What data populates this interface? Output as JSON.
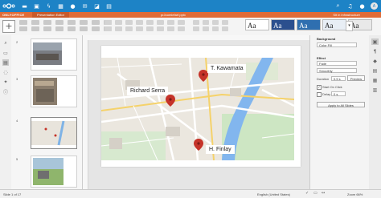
{
  "nextcloud": {
    "apps": [
      "folder-icon",
      "image-icon",
      "pulse-icon",
      "calendar-icon",
      "contacts-icon",
      "mail-icon",
      "deck-icon",
      "office-icon"
    ],
    "right_icons": [
      "search-icon",
      "bell-icon",
      "contacts-icon"
    ],
    "avatar": "A"
  },
  "onlyoffice": {
    "brand": "ONLYOFFICE",
    "tabs": [
      "Presentation Editor",
      "File"
    ],
    "filename": "prJoomlefarf.pptx",
    "user": "Slt in Infrastructure"
  },
  "themes": [
    "Aa",
    "Aa",
    "Aa",
    "Aa",
    "Aa",
    "Aa"
  ],
  "slides": {
    "numbers": [
      "2",
      "3",
      "4",
      "5"
    ]
  },
  "map": {
    "labels": [
      "T. Kawamata",
      "Richard Serra",
      "H. Finlay"
    ]
  },
  "right_panel": {
    "background_title": "Background",
    "background_value": "Color Fill",
    "effect_title": "Effect",
    "effect_value": "Fade",
    "effect_sub": "Smoothly",
    "duration_label": "Duration",
    "duration_value": "0.5 s",
    "preview_label": "Preview",
    "start_on_click": "Start On Click",
    "delay_label": "Delay",
    "delay_value": "0 s",
    "apply_all": "Apply to All Slides"
  },
  "status": {
    "slide_info": "Slide 1 of 17",
    "language": "English (United States)",
    "zoom": "Zoom 66%"
  }
}
